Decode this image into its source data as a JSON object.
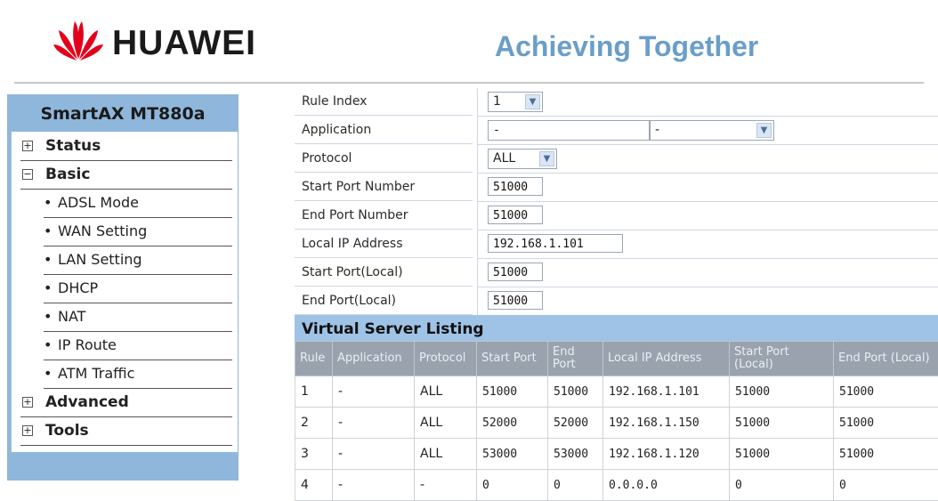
{
  "header": {
    "brand": "HUAWEI",
    "slogan": "Achieving Together"
  },
  "sidebar": {
    "model": "SmartAX MT880a",
    "items": [
      {
        "kind": "top",
        "state": "+",
        "label": "Status"
      },
      {
        "kind": "top",
        "state": "−",
        "label": "Basic"
      },
      {
        "kind": "sub",
        "label": "ADSL Mode"
      },
      {
        "kind": "sub",
        "label": "WAN Setting"
      },
      {
        "kind": "sub",
        "label": "LAN Setting"
      },
      {
        "kind": "sub",
        "label": "DHCP"
      },
      {
        "kind": "sub",
        "label": "NAT"
      },
      {
        "kind": "sub",
        "label": "IP Route"
      },
      {
        "kind": "sub",
        "label": "ATM Traffic"
      },
      {
        "kind": "top",
        "state": "+",
        "label": "Advanced"
      },
      {
        "kind": "top",
        "state": "+",
        "label": "Tools"
      }
    ]
  },
  "form": {
    "rule_index": {
      "label": "Rule Index",
      "value": "1"
    },
    "application": {
      "label": "Application",
      "value1": "-",
      "value2": "-"
    },
    "protocol": {
      "label": "Protocol",
      "value": "ALL"
    },
    "start_port": {
      "label": "Start Port Number",
      "value": "51000"
    },
    "end_port": {
      "label": "End Port Number",
      "value": "51000"
    },
    "local_ip": {
      "label": "Local IP Address",
      "value": "192.168.1.101"
    },
    "start_port_local": {
      "label": "Start Port(Local)",
      "value": "51000"
    },
    "end_port_local": {
      "label": "End Port(Local)",
      "value": "51000"
    }
  },
  "listing": {
    "title": "Virtual Server Listing",
    "headers": [
      "Rule",
      "Application",
      "Protocol",
      "Start Port",
      "End Port",
      "Local IP Address",
      "Start Port (Local)",
      "End Port (Local)"
    ],
    "rows": [
      [
        "1",
        "-",
        "ALL",
        "51000",
        "51000",
        "192.168.1.101",
        "51000",
        "51000"
      ],
      [
        "2",
        "-",
        "ALL",
        "52000",
        "52000",
        "192.168.1.150",
        "51000",
        "51000"
      ],
      [
        "3",
        "-",
        "ALL",
        "53000",
        "53000",
        "192.168.1.120",
        "51000",
        "51000"
      ],
      [
        "4",
        "-",
        "-",
        "0",
        "0",
        "0.0.0.0",
        "0",
        "0"
      ]
    ]
  },
  "colors": {
    "sidebar": "#8fb7dc",
    "slogan": "#6a9ec8",
    "logo_red": "#e3001b",
    "listing_bar": "#9fc3e6"
  }
}
